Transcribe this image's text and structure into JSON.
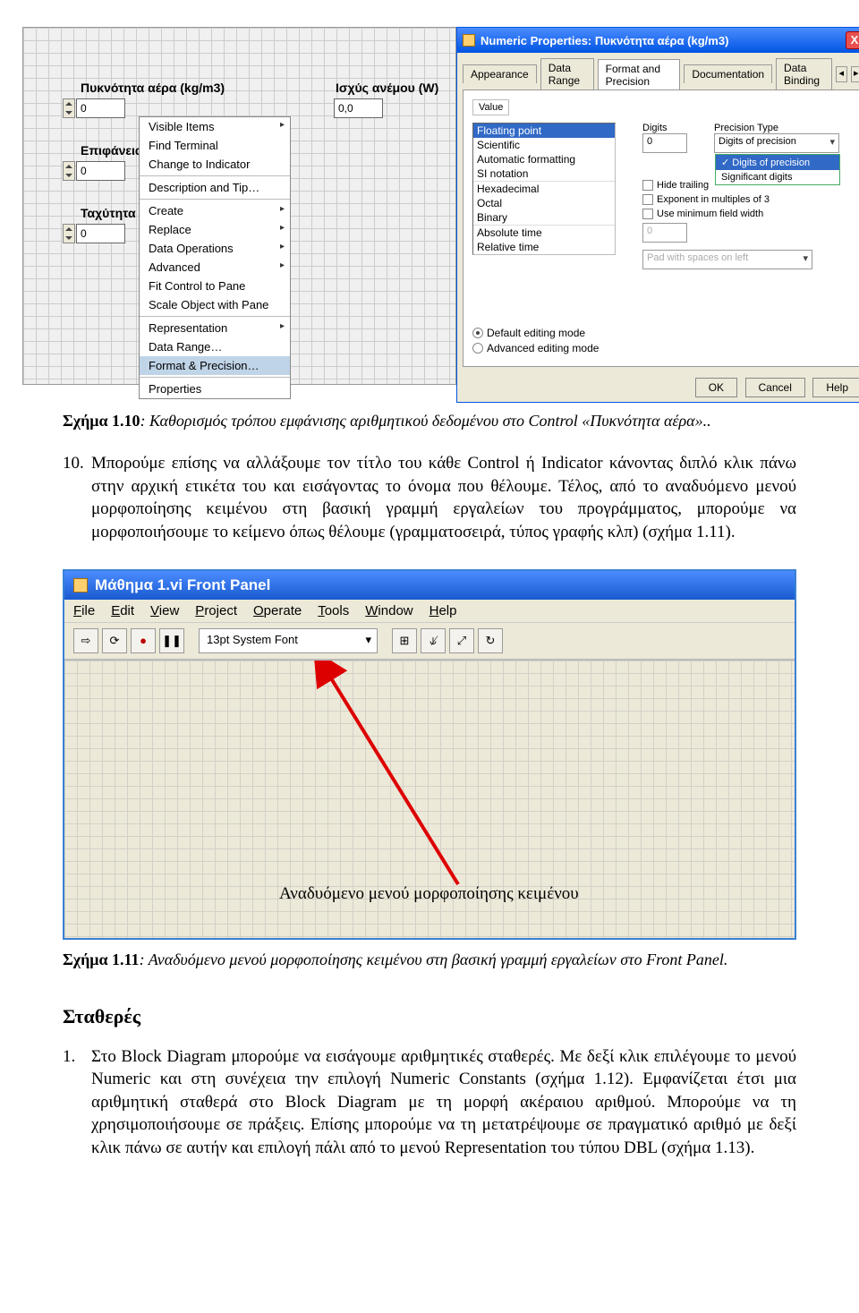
{
  "fig1": {
    "controls": {
      "density_label": "Πυκνότητα αέρα (kg/m3)",
      "density_val": "0",
      "power_label": "Ισχύς ανέμου (W)",
      "power_val": "0,0",
      "area_label": "Επιφάνεια σ",
      "area_val": "0",
      "speed_label": "Ταχύτητα αν",
      "speed_val": "0"
    },
    "ctx_menu": [
      "Visible Items",
      "Find Terminal",
      "Change to Indicator",
      "Description and Tip…",
      "Create",
      "Replace",
      "Data Operations",
      "Advanced",
      "Fit Control to Pane",
      "Scale Object with Pane",
      "Representation",
      "Data Range…",
      "Format & Precision…",
      "Properties"
    ],
    "ctx_subs": [
      0,
      4,
      5,
      6,
      7,
      10
    ],
    "ctx_highlight": 12,
    "dialog": {
      "title": "Numeric Properties: Πυκνότητα αέρα (kg/m3)",
      "tabs": [
        "Appearance",
        "Data Range",
        "Format and Precision",
        "Documentation",
        "Data Binding"
      ],
      "active_tab": 2,
      "value_label": "Value",
      "listbox": [
        "Floating point",
        "Scientific",
        "Automatic formatting",
        "SI notation",
        "Hexadecimal",
        "Octal",
        "Binary",
        "Absolute time",
        "Relative time"
      ],
      "listbox_sel": 0,
      "listbox_segs": [
        4,
        7
      ],
      "digits_label": "Digits",
      "digits_val": "0",
      "precision_label": "Precision Type",
      "precision_val": "Digits of precision",
      "dd_options": [
        "Digits of precision",
        "Significant digits"
      ],
      "dd_sel": 0,
      "cb1": "Hide trailing",
      "cb2": "Exponent in multiples of 3",
      "cb3": "Use minimum field width",
      "min_width_val": "0",
      "pad_label": "Pad with spaces on left",
      "radio1": "Default editing mode",
      "radio2": "Advanced editing mode",
      "btn_ok": "OK",
      "btn_cancel": "Cancel",
      "btn_help": "Help"
    }
  },
  "caption1": "Σχήμα 1.10: Καθορισμός τρόπου εμφάνισης αριθμητικού δεδομένου στο Control «Πυκνότητα αέρα»..",
  "para10_num": "10.",
  "para10": "Μπορούμε επίσης να αλλάξουμε τον τίτλο του κάθε Control ή Indicator κάνοντας διπλό κλικ πάνω στην αρχική ετικέτα του και εισάγοντας το όνομα που θέλουμε. Τέλος, από το αναδυόμενο μενού μορφοποίησης κειμένου στη βασική γραμμή εργαλείων του προγράμματος, μπορούμε να μορφοποιήσουμε το κείμενο όπως θέλουμε (γραμματοσειρά, τύπος γραφής κλπ) (σχήμα 1.11).",
  "fig2": {
    "title": "Μάθημα 1.vi Front Panel",
    "menu": [
      "File",
      "Edit",
      "View",
      "Project",
      "Operate",
      "Tools",
      "Window",
      "Help"
    ],
    "toolbar_icons": [
      "run-arrow",
      "run-cont",
      "stop",
      "pause"
    ],
    "font": "13pt System Font",
    "align_icons": [
      "align",
      "distribute",
      "resize",
      "reorder"
    ],
    "annotation": "Αναδυόμενο μενού μορφοποίησης κειμένου"
  },
  "caption2": "Σχήμα 1.11: Αναδυόμενο μενού μορφοποίησης κειμένου στη βασική γραμμή εργαλείων στο Front Panel.",
  "heading": "Σταθερές",
  "para1_num": "1.",
  "para1": "Στο Block Diagram μπορούμε να εισάγουμε αριθμητικές σταθερές. Με δεξί κλικ επιλέγουμε το μενού Numeric και στη συνέχεια την επιλογή Numeric Constants (σχήμα 1.12). Εμφανίζεται έτσι μια αριθμητική σταθερά στο Block Diagram με τη μορφή ακέραιου αριθμού. Μπορούμε να τη χρησιμοποιήσουμε σε πράξεις. Επίσης μπορούμε να τη μετατρέψουμε σε πραγματικό αριθμό με δεξί κλικ πάνω σε αυτήν και επιλογή πάλι από το μενού Representation του τύπου DBL (σχήμα 1.13)."
}
